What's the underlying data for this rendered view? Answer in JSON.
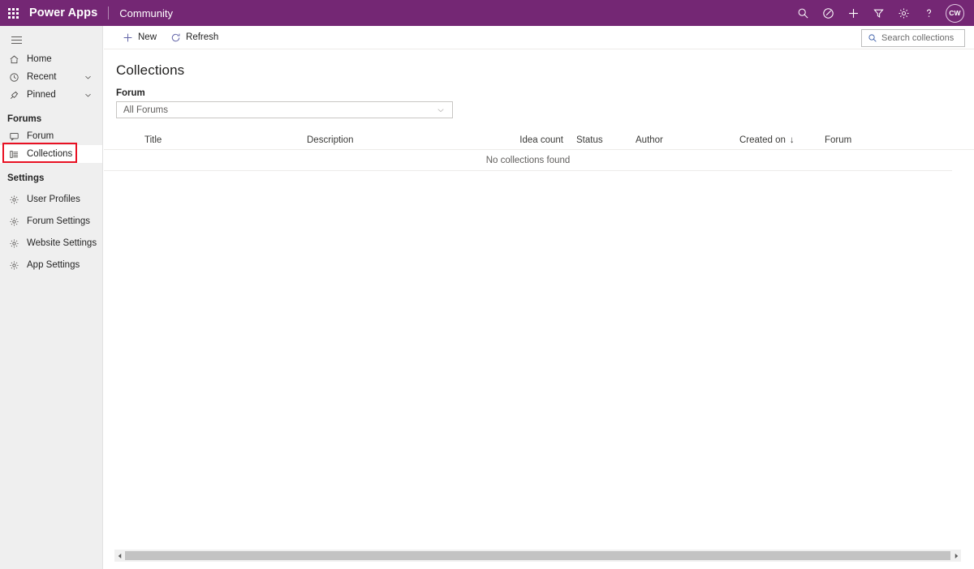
{
  "header": {
    "waffle_icon": "app-launcher-waffle-icon",
    "brand": "Power Apps",
    "subtitle": "Community",
    "actions": [
      {
        "name": "search-icon",
        "label": "Search"
      },
      {
        "name": "assist-icon",
        "label": "Assistant"
      },
      {
        "name": "plus-icon",
        "label": "New"
      },
      {
        "name": "filter-icon",
        "label": "Filter"
      },
      {
        "name": "gear-icon",
        "label": "Settings"
      },
      {
        "name": "help-icon",
        "label": "Help"
      }
    ],
    "avatar_initials": "CW"
  },
  "sidebar": {
    "hamburger_label": "Show more",
    "items": [
      {
        "label": "Home",
        "icon": "home-icon",
        "chevron": false,
        "selected": false
      },
      {
        "label": "Recent",
        "icon": "clock-icon",
        "chevron": true,
        "selected": false
      },
      {
        "label": "Pinned",
        "icon": "pin-icon",
        "chevron": true,
        "selected": false
      }
    ],
    "groups": [
      {
        "title": "Forums",
        "items": [
          {
            "label": "Forum",
            "icon": "forum-icon",
            "selected": false
          },
          {
            "label": "Collections",
            "icon": "list-icon",
            "selected": true
          }
        ]
      },
      {
        "title": "Settings",
        "items": [
          {
            "label": "User Profiles",
            "icon": "gear-icon",
            "selected": false
          },
          {
            "label": "Forum Settings",
            "icon": "gear-icon",
            "selected": false
          },
          {
            "label": "Website Settings",
            "icon": "gear-icon",
            "selected": false
          },
          {
            "label": "App Settings",
            "icon": "gear-icon",
            "selected": false
          }
        ]
      }
    ]
  },
  "command_bar": {
    "new_label": "New",
    "refresh_label": "Refresh",
    "search_placeholder": "Search collections",
    "search_value": ""
  },
  "main": {
    "title": "Collections",
    "filter_label": "Forum",
    "filter_value": "All Forums",
    "columns": [
      "Title",
      "Description",
      "Idea count",
      "Status",
      "Author",
      "Created on",
      "Forum"
    ],
    "sort_column": "Created on",
    "sort_direction": "↓",
    "rows": [],
    "empty_message": "No collections found"
  },
  "scrollbar": {
    "left_arrow": "scroll-left-arrow",
    "right_arrow": "scroll-right-arrow"
  },
  "colors": {
    "brand_purple": "#742774",
    "accent_blue": "#6264a7",
    "annotation_red": "#e81123",
    "sidebar_bg": "#efefef"
  }
}
